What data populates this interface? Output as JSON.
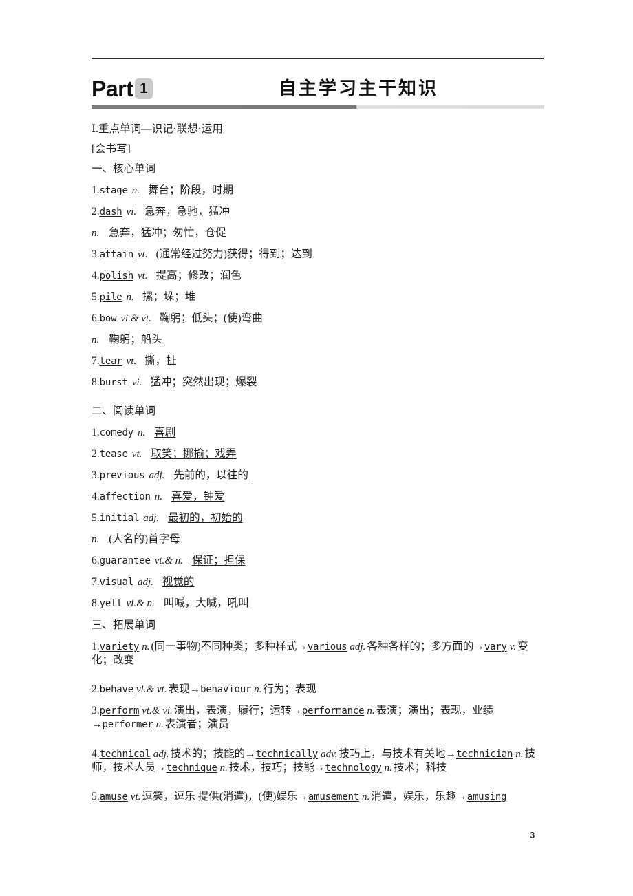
{
  "page": {
    "number": "3"
  },
  "header": {
    "part_label": "Part",
    "part_number": "1",
    "title": "自主学习主干知识"
  },
  "intro": {
    "roman_heading": "Ⅰ.重点单词—识记·联想·运用",
    "bracket_heading": "[会书写]"
  },
  "sections": {
    "core": {
      "heading": "一、核心单词",
      "entries": [
        {
          "num": "1.",
          "word": "stage",
          "pos": "n.",
          "meaning": "舞台；阶段，时期"
        },
        {
          "num": "2.",
          "word": "dash",
          "pos": "vi.",
          "meaning": "急奔，急驰，猛冲"
        },
        {
          "num": "",
          "word": "",
          "pos": "n.",
          "meaning": "急奔，猛冲；匆忙，仓促"
        },
        {
          "num": "3.",
          "word": "attain",
          "pos": "vt.",
          "meaning": "(通常经过努力)获得；得到；达到"
        },
        {
          "num": "4.",
          "word": "polish",
          "pos": "vt.",
          "meaning": "提高；修改；润色"
        },
        {
          "num": "5.",
          "word": "pile",
          "pos": "n.",
          "meaning": "摞；垛；堆"
        },
        {
          "num": "6.",
          "word": "bow",
          "pos": "vi.& vt.",
          "meaning": "鞠躬；低头；(使)弯曲"
        },
        {
          "num": "",
          "word": "",
          "pos": "n.",
          "meaning": "鞠躬；船头"
        },
        {
          "num": "7.",
          "word": "tear",
          "pos": "vt.",
          "meaning": "撕，扯"
        },
        {
          "num": "8.",
          "word": "burst",
          "pos": "vi.",
          "meaning": "猛冲；突然出现；爆裂"
        }
      ]
    },
    "reading": {
      "heading": "二、阅读单词",
      "entries": [
        {
          "num": "1.",
          "word": "comedy",
          "pos": "n.",
          "meaning": "喜剧"
        },
        {
          "num": "2.",
          "word": "tease",
          "pos": "vt.",
          "meaning": "取笑；挪揄；戏弄"
        },
        {
          "num": "3.",
          "word": "previous",
          "pos": "adj.",
          "meaning": "先前的，以往的"
        },
        {
          "num": "4.",
          "word": "affection",
          "pos": "n.",
          "meaning": "喜爱，钟爱"
        },
        {
          "num": "5.",
          "word": "initial",
          "pos": "adj.",
          "meaning": "最初的，初始的"
        },
        {
          "num": "",
          "word": "",
          "pos": "n.",
          "meaning": "(人名的)首字母"
        },
        {
          "num": "6.",
          "word": "guarantee",
          "pos": "vt.& n.",
          "meaning": "保证；担保"
        },
        {
          "num": "7.",
          "word": "visual",
          "pos": "adj.",
          "meaning": "视觉的"
        },
        {
          "num": "8.",
          "word": "yell",
          "pos": "vi.& n.",
          "meaning": "叫喊，大喊，吼叫"
        }
      ]
    },
    "extension": {
      "heading": "三、拓展单词",
      "entries": [
        {
          "num": "1.",
          "parts": [
            {
              "t": "word",
              "v": "variety"
            },
            {
              "t": "pos",
              "v": "n."
            },
            {
              "t": "cn",
              "v": "(同一事物)不同种类；多种样式"
            },
            {
              "t": "arrow",
              "v": "→"
            },
            {
              "t": "word",
              "v": "various"
            },
            {
              "t": "pos",
              "v": "adj."
            },
            {
              "t": "cn",
              "v": "各种各样的；多方面的"
            },
            {
              "t": "arrow",
              "v": "→"
            },
            {
              "t": "word",
              "v": "vary"
            },
            {
              "t": "pos",
              "v": "v."
            },
            {
              "t": "cn",
              "v": "变化；改变"
            }
          ]
        },
        {
          "num": "2.",
          "parts": [
            {
              "t": "word",
              "v": "behave"
            },
            {
              "t": "pos",
              "v": "vi.& vt."
            },
            {
              "t": "cn",
              "v": "表现"
            },
            {
              "t": "arrow",
              "v": "→"
            },
            {
              "t": "word",
              "v": "behaviour"
            },
            {
              "t": "pos",
              "v": "n."
            },
            {
              "t": "cn",
              "v": "行为；表现"
            }
          ]
        },
        {
          "num": "3.",
          "parts": [
            {
              "t": "word",
              "v": "perform"
            },
            {
              "t": "pos",
              "v": "vt.& vi."
            },
            {
              "t": "cn",
              "v": "演出，表演，履行；运转"
            },
            {
              "t": "arrow",
              "v": "→"
            },
            {
              "t": "word",
              "v": "performance"
            },
            {
              "t": "pos",
              "v": "n."
            },
            {
              "t": "cn",
              "v": "表演；演出；表现，业绩"
            },
            {
              "t": "arrow",
              "v": "→"
            },
            {
              "t": "word",
              "v": "performer"
            },
            {
              "t": "pos",
              "v": "n."
            },
            {
              "t": "cn",
              "v": "表演者；演员"
            }
          ]
        },
        {
          "num": "4.",
          "parts": [
            {
              "t": "word",
              "v": "technical"
            },
            {
              "t": "pos",
              "v": "adj."
            },
            {
              "t": "cn",
              "v": "技术的；技能的"
            },
            {
              "t": "arrow",
              "v": "→"
            },
            {
              "t": "word",
              "v": "technically"
            },
            {
              "t": "pos",
              "v": "adv."
            },
            {
              "t": "cn",
              "v": "技巧上，与技术有关地"
            },
            {
              "t": "arrow",
              "v": "→"
            },
            {
              "t": "word",
              "v": "technician"
            },
            {
              "t": "pos",
              "v": "n."
            },
            {
              "t": "cn",
              "v": "技师，技术人员"
            },
            {
              "t": "arrow",
              "v": "→"
            },
            {
              "t": "word",
              "v": "technique"
            },
            {
              "t": "pos",
              "v": "n."
            },
            {
              "t": "cn",
              "v": "技术，技巧；技能"
            },
            {
              "t": "arrow",
              "v": "→"
            },
            {
              "t": "word",
              "v": "technology"
            },
            {
              "t": "pos",
              "v": "n."
            },
            {
              "t": "cn",
              "v": "技术；科技"
            }
          ]
        },
        {
          "num": "5.",
          "parts": [
            {
              "t": "word",
              "v": "amuse"
            },
            {
              "t": "pos",
              "v": "vt."
            },
            {
              "t": "cn",
              "v": "逗笑，逗乐 提供(消遣)，(使)娱乐"
            },
            {
              "t": "arrow",
              "v": "→"
            },
            {
              "t": "word",
              "v": "amusement"
            },
            {
              "t": "pos",
              "v": "n."
            },
            {
              "t": "cn",
              "v": "消遣，娱乐，乐趣"
            },
            {
              "t": "arrow",
              "v": "→"
            },
            {
              "t": "word",
              "v": "amusing"
            }
          ]
        }
      ]
    }
  }
}
